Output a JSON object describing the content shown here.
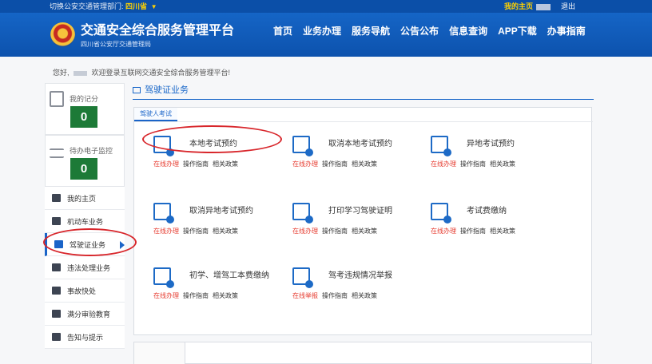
{
  "topbar": {
    "region_prefix": "切换公安交通管理部门:",
    "region_name": "四川省",
    "region_caret": "▼",
    "my_home": "我的主页",
    "logout": "退出"
  },
  "header": {
    "title": "交通安全综合服务管理平台",
    "subtitle": "四川省公安厅交通管理局",
    "nav": [
      "首页",
      "业务办理",
      "服务导航",
      "公告公布",
      "信息查询",
      "APP下载",
      "办事指南"
    ]
  },
  "welcome": {
    "prefix": "您好,",
    "suffix": "欢迎登录互联网交通安全综合服务管理平台!"
  },
  "sidebar": {
    "score": {
      "label": "我的记分",
      "value": "0"
    },
    "monitor": {
      "label": "待办电子监控",
      "value": "0"
    },
    "items": [
      {
        "label": "我的主页",
        "icon": "home-icon"
      },
      {
        "label": "机动车业务",
        "icon": "car-icon"
      },
      {
        "label": "驾驶证业务",
        "icon": "license-icon",
        "active": true
      },
      {
        "label": "违法处理业务",
        "icon": "camera-icon"
      },
      {
        "label": "事故快处",
        "icon": "accident-icon"
      },
      {
        "label": "满分审验教育",
        "icon": "education-icon"
      },
      {
        "label": "告知与提示",
        "icon": "bell-icon"
      }
    ]
  },
  "section": {
    "title": "驾驶证业务",
    "tab": "驾驶人考试"
  },
  "services": [
    {
      "title": "本地考试预约",
      "action": "在线办理",
      "guide": "操作指南",
      "policy": "相关政策"
    },
    {
      "title": "取消本地考试预约",
      "action": "在线办理",
      "guide": "操作指南",
      "policy": "相关政策"
    },
    {
      "title": "异地考试预约",
      "action": "在线办理",
      "guide": "操作指南",
      "policy": "相关政策"
    },
    {
      "title": "取消异地考试预约",
      "action": "在线办理",
      "guide": "操作指南",
      "policy": "相关政策"
    },
    {
      "title": "打印学习驾驶证明",
      "action": "在线办理",
      "guide": "操作指南",
      "policy": "相关政策"
    },
    {
      "title": "考试费缴纳",
      "action": "在线办理",
      "guide": "操作指南",
      "policy": "相关政策"
    },
    {
      "title": "初学、增驾工本费缴纳",
      "action": "在线办理",
      "guide": "操作指南",
      "policy": "相关政策"
    },
    {
      "title": "驾考违规情况举报",
      "action": "在线举报",
      "guide": "操作指南",
      "policy": "相关政策"
    }
  ],
  "colors": {
    "primary": "#1a64c8",
    "header": "#0d52ad",
    "counter": "#1d7a37",
    "action": "#e63b2f",
    "highlight": "#d8262b"
  }
}
